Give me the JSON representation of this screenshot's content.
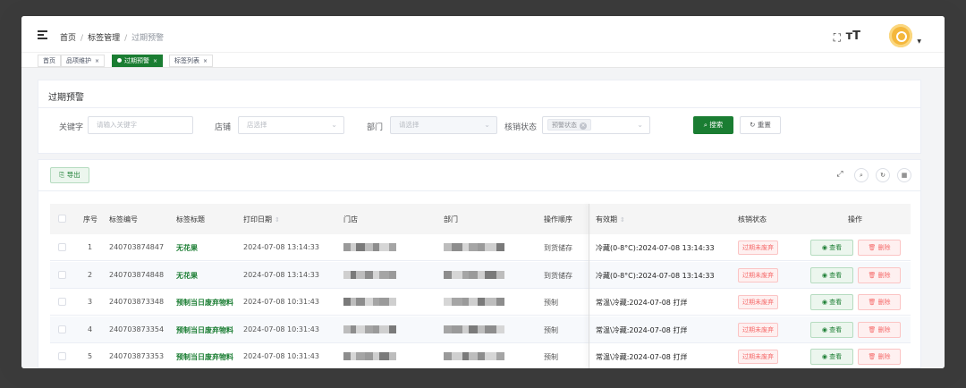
{
  "breadcrumb": {
    "home": "首页",
    "section": "标签管理",
    "current": "过期预警",
    "sep": "/"
  },
  "header": {
    "fullscreen_icon": "⛶",
    "font_icon": "тТ",
    "caret": "▼"
  },
  "tags": [
    {
      "label": "首页",
      "active": false,
      "closable": false
    },
    {
      "label": "品项维护",
      "active": false,
      "closable": true
    },
    {
      "label": "过期预警",
      "active": true,
      "closable": true
    },
    {
      "label": "标签列表",
      "active": false,
      "closable": true
    }
  ],
  "tag_close": "×",
  "search": {
    "title": "过期预警",
    "keyword_label": "关键字",
    "keyword_placeholder": "请输入关键字",
    "store_label": "店铺",
    "store_placeholder": "店选择",
    "dept_label": "部门",
    "dept_placeholder": "请选择",
    "status_label": "核销状态",
    "status_chip": "预警状态",
    "search_btn": "搜索",
    "reset_btn": "重置",
    "search_icon": "⌕",
    "reset_icon": "↻"
  },
  "toolbar": {
    "export": "导出",
    "export_icon": "⎘",
    "icons": [
      "⤢",
      "⌕",
      "↻",
      "▦"
    ]
  },
  "columns": {
    "seq": "序号",
    "code": "标签编号",
    "title": "标签标题",
    "print": "打印日期",
    "store": "门店",
    "dept": "部门",
    "op": "操作顺序",
    "valid": "有效期",
    "status": "核销状态",
    "action": "操作"
  },
  "sort_icon": "⇕",
  "rows": [
    {
      "seq": "1",
      "code": "240703874847",
      "title": "无花果",
      "print": "2024-07-08 13:14:33",
      "op": "到货储存",
      "valid": "冷藏(0-8°C):2024-07-08 13:14:33",
      "status": "过期未废弃"
    },
    {
      "seq": "2",
      "code": "240703874848",
      "title": "无花果",
      "print": "2024-07-08 13:14:33",
      "op": "到货储存",
      "valid": "冷藏(0-8°C):2024-07-08 13:14:33",
      "status": "过期未废弃"
    },
    {
      "seq": "3",
      "code": "240703873348",
      "title": "预制当日废弃物料",
      "print": "2024-07-08 10:31:43",
      "op": "预制",
      "valid": "常温\\冷藏:2024-07-08 打烊",
      "status": "过期未废弃"
    },
    {
      "seq": "4",
      "code": "240703873354",
      "title": "预制当日废弃物料",
      "print": "2024-07-08 10:31:43",
      "op": "预制",
      "valid": "常温\\冷藏:2024-07-08 打烊",
      "status": "过期未废弃"
    },
    {
      "seq": "5",
      "code": "240703873353",
      "title": "预制当日废弃物料",
      "print": "2024-07-08 10:31:43",
      "op": "预制",
      "valid": "常温\\冷藏:2024-07-08 打烊",
      "status": "过期未废弃"
    }
  ],
  "actions": {
    "view": "查看",
    "delete": "删除",
    "view_icon": "◉",
    "delete_icon": "🗑"
  },
  "colors": {
    "primary": "#1a7d32",
    "danger": "#f56c6c",
    "bezel": "#3a3a3a"
  }
}
